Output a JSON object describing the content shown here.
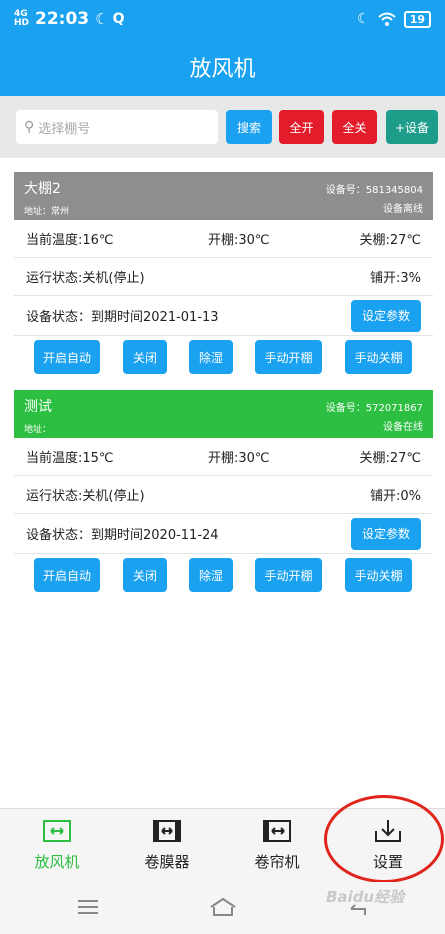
{
  "status_bar": {
    "network_top": "4G",
    "network_bottom": "HD",
    "time": "22:03",
    "battery": "19"
  },
  "header": {
    "title": "放风机"
  },
  "search": {
    "placeholder": "选择棚号",
    "search_label": "搜索",
    "all_open_label": "全开",
    "all_close_label": "全关",
    "add_device_label": "+设备"
  },
  "devices": [
    {
      "name": "大棚2",
      "address": "地址：常州",
      "device_id": "设备号：581345804",
      "online_state": "设备离线",
      "temperature": "当前温度:16℃",
      "open_threshold": "开棚:30℃",
      "close_threshold": "关棚:27℃",
      "run_status": "运行状态:关机(停止)",
      "spread": "铺开:3%",
      "device_status": "设备状态：到期时间2021-01-13",
      "params_label": "设定参数",
      "actions": [
        "开启自动",
        "关闭",
        "除湿",
        "手动开棚",
        "手动关棚"
      ]
    },
    {
      "name": "测试",
      "address": "地址：",
      "device_id": "设备号：572071867",
      "online_state": "设备在线",
      "temperature": "当前温度:15℃",
      "open_threshold": "开棚:30℃",
      "close_threshold": "关棚:27℃",
      "run_status": "运行状态:关机(停止)",
      "spread": "铺开:0%",
      "device_status": "设备状态：到期时间2020-11-24",
      "params_label": "设定参数",
      "actions": [
        "开启自动",
        "关闭",
        "除湿",
        "手动开棚",
        "手动关棚"
      ]
    }
  ],
  "tabs": [
    {
      "label": "放风机",
      "icon": "ventilator-icon"
    },
    {
      "label": "卷膜器",
      "icon": "film-roller-icon"
    },
    {
      "label": "卷帘机",
      "icon": "curtain-roller-icon"
    },
    {
      "label": "设置",
      "icon": "download-tray-icon"
    }
  ],
  "watermark": "Baidu经验",
  "colors": {
    "primary": "#1aa1ef",
    "danger": "#e31c2c",
    "teal": "#1f9d8b",
    "online": "#2cbf42",
    "offline": "#8e8e8e",
    "highlight": "#e0241b"
  }
}
